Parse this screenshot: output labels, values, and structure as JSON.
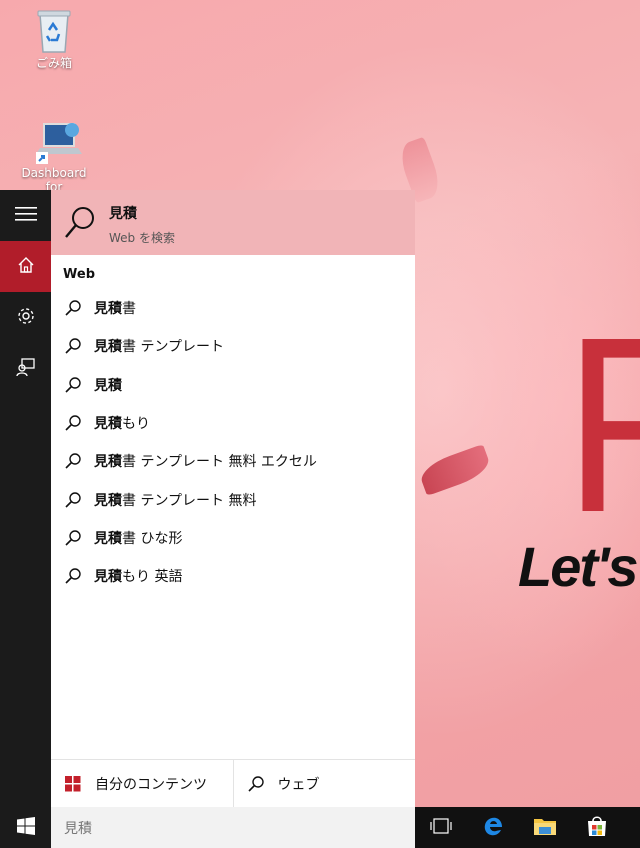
{
  "desktop": {
    "icons": [
      {
        "label": "ごみ箱",
        "icon": "recycle-bin-icon"
      },
      {
        "label": "Dashboard for",
        "icon": "dashboard-app-icon"
      }
    ],
    "wallpaper": {
      "big_letter": "R",
      "brand_text": "Let's"
    }
  },
  "rail": {
    "items": [
      {
        "icon": "hamburger-menu-icon"
      },
      {
        "icon": "home-icon",
        "active": true
      },
      {
        "icon": "settings-gear-icon"
      },
      {
        "icon": "feedback-icon"
      }
    ]
  },
  "search_panel": {
    "top_result": {
      "title": "見積",
      "subtitle": "Web を検索"
    },
    "section_title": "Web",
    "suggestions": [
      {
        "bold": "見積",
        "rest": "書"
      },
      {
        "bold": "見積",
        "rest": "書 テンプレート"
      },
      {
        "bold": "見積",
        "rest": ""
      },
      {
        "bold": "見積",
        "rest": "もり"
      },
      {
        "bold": "見積",
        "rest": "書 テンプレート 無料 エクセル"
      },
      {
        "bold": "見積",
        "rest": "書 テンプレート 無料"
      },
      {
        "bold": "見積",
        "rest": "書 ひな形"
      },
      {
        "bold": "見積",
        "rest": "もり 英語"
      }
    ],
    "tabs": {
      "my_content": "自分のコンテンツ",
      "web": "ウェブ"
    }
  },
  "taskbar": {
    "search_value": "見積",
    "icons": [
      "task-view-icon",
      "edge-icon",
      "file-explorer-icon",
      "store-icon"
    ]
  },
  "colors": {
    "accent": "#b11d2a",
    "highlight": "#f1b4b7",
    "rail": "#1b1b1b"
  }
}
